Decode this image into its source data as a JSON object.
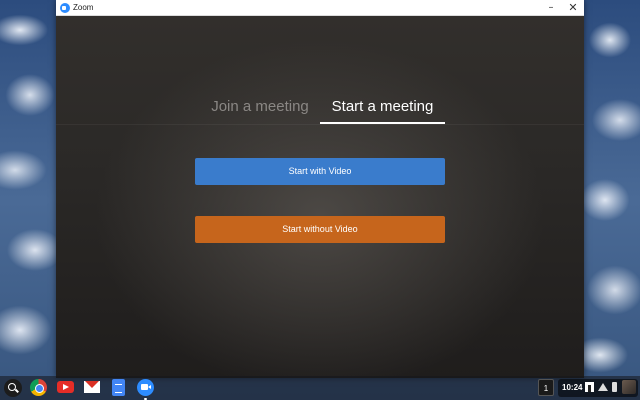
{
  "window": {
    "title": "Zoom",
    "minimize_glyph": "–",
    "close_glyph": "✕"
  },
  "tabs": [
    {
      "label": "Join a meeting",
      "active": false
    },
    {
      "label": "Start a meeting",
      "active": true
    }
  ],
  "buttons": {
    "start_with_video": {
      "label": "Start with Video",
      "color": "#3a7ccc"
    },
    "start_without_video": {
      "label": "Start without Video",
      "color": "#c6651c"
    }
  },
  "shelf": {
    "apps": [
      "search-launcher",
      "chrome-icon",
      "youtube-icon",
      "gmail-icon",
      "docs-icon",
      "zoom-icon"
    ],
    "desk_number": "1",
    "clock": "10:24"
  }
}
